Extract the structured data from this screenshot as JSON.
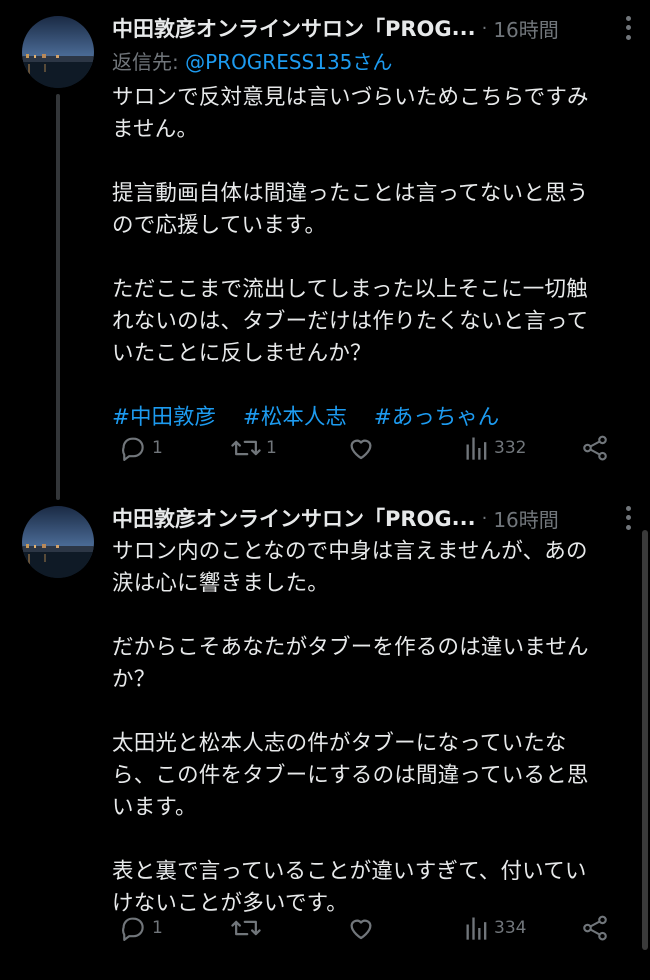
{
  "tweets": [
    {
      "author": "中田敦彦オンラインサロン「PROG",
      "ellipsis": "...",
      "separator": "·",
      "time": "16時間",
      "reply_prefix": "返信先: ",
      "reply_handle": "@PROGRESS135さん",
      "text": "サロンで反対意見は言いづらいためこちらですみ\nません。\n\n提言動画自体は間違ったことは言ってないと思う\nので応援しています。\n\nただここまで流出してしまった以上そこに一切触\nれないのは、タブーだけは作りたくないと言って\nいたことに反しませんか？",
      "hashtags": [
        "#中田敦彦",
        "#松本人志",
        "#あっちゃん"
      ],
      "replies": "1",
      "retweets": "1",
      "likes": "",
      "views": "332"
    },
    {
      "author": "中田敦彦オンラインサロン「PROG",
      "ellipsis": "...",
      "separator": "·",
      "time": "16時間",
      "text": "サロン内のことなので中身は言えませんが、あの\n涙は心に響きました。\n\nだからこそあなたがタブーを作るのは違いません\nか？\n\n太田光と松本人志の件がタブーになっていたな\nら、この件をタブーにするのは間違っていると思\nいます。\n\n表と裏で言っていることが違いすぎて、付いてい\nけないことが多いです。",
      "replies": "1",
      "retweets": "",
      "likes": "",
      "views": "334"
    }
  ],
  "icons": {
    "reply": "reply-icon",
    "retweet": "retweet-icon",
    "like": "heart-icon",
    "views": "views-icon",
    "share": "share-icon",
    "more": "more-icon"
  },
  "colors": {
    "background": "#000000",
    "text": "#e7e9ea",
    "muted": "#71767b",
    "link": "#1d9bf0"
  }
}
